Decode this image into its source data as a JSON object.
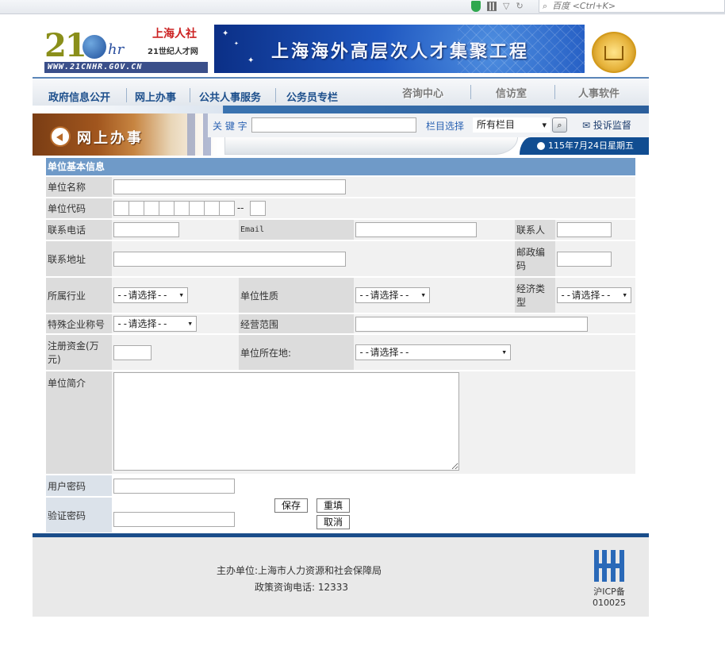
{
  "browser": {
    "search_placeholder": "百度 <Ctrl+K>"
  },
  "header": {
    "logo_number": "21",
    "logo_hr": "hr",
    "logo_org": "上海人社",
    "logo_sub": "21世纪人才网",
    "logo_url": "WWW.21CNHR.GOV.CN",
    "banner_title": "上海海外高层次人才集聚工程"
  },
  "nav": {
    "items": [
      "政府信息公开",
      "网上办事",
      "公共人事服务",
      "公务员专栏"
    ],
    "right_items": [
      "咨询中心",
      "信访室",
      "人事软件"
    ]
  },
  "subheader": {
    "section_title": "网上办事",
    "keyword_label": "关 键 字",
    "column_label": "栏目选择",
    "column_value": "所有栏目",
    "complain_label": "投诉监督",
    "date_text": "115年7月24日星期五"
  },
  "form": {
    "title": "单位基本信息",
    "labels": {
      "unit_name": "单位名称",
      "unit_code": "单位代码",
      "code_dash": "--",
      "phone": "联系电话",
      "email": "Email",
      "contact": "联系人",
      "address": "联系地址",
      "postcode": "邮政编码",
      "industry": "所属行业",
      "nature": "单位性质",
      "econ_type": "经济类型",
      "special": "特殊企业称号",
      "scope": "经营范围",
      "capital": "注册资金(万元)",
      "location": "单位所在地:",
      "intro": "单位简介",
      "password": "用户密码",
      "confirm_password": "验证密码"
    },
    "select_placeholder": "--请选择--",
    "buttons": {
      "save": "保存",
      "reset": "重填",
      "cancel": "取消"
    }
  },
  "footer": {
    "sponsor": "主办单位:上海市人力资源和社会保障局",
    "hotline": "政策资询电话: 12333",
    "icp_line1": "沪ICP备",
    "icp_line2": "010025"
  },
  "colors": {
    "nav_text": "#1d4f8c",
    "form_header": "#6f9ac8",
    "footer_bar": "#1a4d8a",
    "date_bar": "#114d91"
  }
}
